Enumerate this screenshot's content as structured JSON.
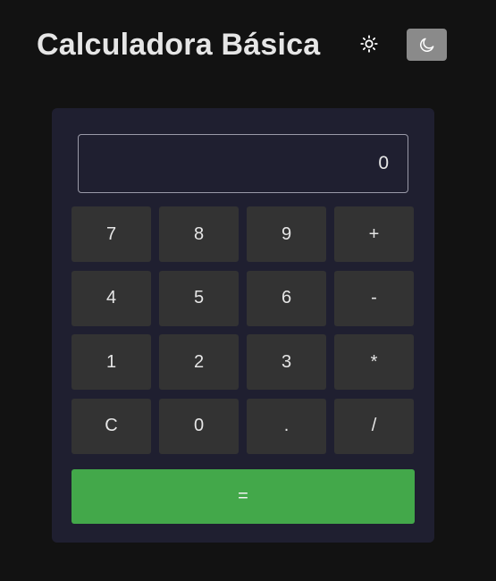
{
  "header": {
    "title": "Calculadora Básica",
    "light_icon": "sun-icon",
    "dark_icon": "moon-icon"
  },
  "display": {
    "value": "0"
  },
  "keys": [
    "7",
    "8",
    "9",
    "+",
    "4",
    "5",
    "6",
    "-",
    "1",
    "2",
    "3",
    "*",
    "C",
    "0",
    ".",
    "/"
  ],
  "equals_label": "=",
  "colors": {
    "background": "#121212",
    "panel": "#1f1f30",
    "key": "#333333",
    "equals": "#43a84a",
    "toggle": "#8a8a8a"
  }
}
